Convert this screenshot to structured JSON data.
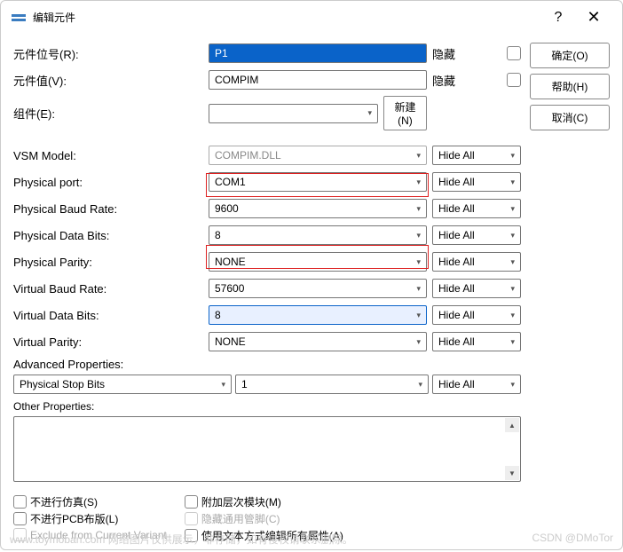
{
  "title": "编辑元件",
  "buttons": {
    "ok": "确定(O)",
    "help": "帮助(H)",
    "cancel": "取消(C)"
  },
  "top": {
    "ref_label": "元件位号(R):",
    "ref_value": "P1",
    "ref_hide": "隐藏",
    "val_label": "元件值(V):",
    "val_value": "COMPIM",
    "val_hide": "隐藏",
    "grp_label": "组件(E):",
    "grp_value": "",
    "new_btn": "新建(N)"
  },
  "props": [
    {
      "label": "VSM Model:",
      "value": "COMPIM.DLL",
      "ro": true,
      "vis": "Hide All"
    },
    {
      "label": "Physical port:",
      "value": "COM1",
      "vis": "Hide All"
    },
    {
      "label": "Physical Baud Rate:",
      "value": "9600",
      "vis": "Hide All"
    },
    {
      "label": "Physical Data Bits:",
      "value": "8",
      "vis": "Hide All"
    },
    {
      "label": "Physical Parity:",
      "value": "NONE",
      "vis": "Hide All"
    },
    {
      "label": "Virtual Baud Rate:",
      "value": "57600",
      "vis": "Hide All"
    },
    {
      "label": "Virtual Data Bits:",
      "value": "8",
      "vis": "Hide All",
      "hl": true
    },
    {
      "label": "Virtual Parity:",
      "value": "NONE",
      "vis": "Hide All"
    }
  ],
  "adv": {
    "label": "Advanced Properties:",
    "c1": "Physical Stop Bits",
    "c2": "1",
    "c3": "Hide All"
  },
  "other_label": "Other Properties:",
  "checks": {
    "left": [
      {
        "txt": "不进行仿真(S)"
      },
      {
        "txt": "不进行PCB布版(L)"
      },
      {
        "txt": "Exclude from Current Variant",
        "disabled": true
      }
    ],
    "right": [
      {
        "txt": "附加层次模块(M)"
      },
      {
        "txt": "隐藏通用管脚(C)",
        "disabled": true
      },
      {
        "txt": "使用文本方式编辑所有属性(A)"
      }
    ]
  },
  "watermark_left": "www.toymoban.com 网络图片仅供展示，非存储，如有侵权请联系删除。",
  "watermark_right": "CSDN @DMoTor"
}
